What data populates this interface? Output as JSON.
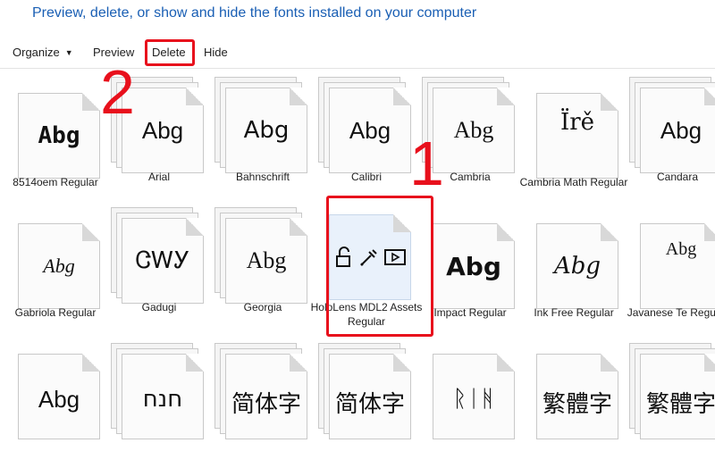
{
  "header": {
    "title": "Preview, delete, or show and hide the fonts installed on your computer"
  },
  "toolbar": {
    "organize": "Organize",
    "preview": "Preview",
    "delete": "Delete",
    "hide": "Hide"
  },
  "annotations": {
    "one": "1",
    "two": "2"
  },
  "fonts": [
    {
      "label": "8514oem Regular",
      "sample": "Abg"
    },
    {
      "label": "Arial",
      "sample": "Abg"
    },
    {
      "label": "Bahnschrift",
      "sample": "Abg"
    },
    {
      "label": "Calibri",
      "sample": "Abg"
    },
    {
      "label": "Cambria",
      "sample": "Abg"
    },
    {
      "label": "Cambria Math Regular",
      "sample": "Ïrě"
    },
    {
      "label": "Candara",
      "sample": "Abg"
    },
    {
      "label": "Gabriola Regular",
      "sample": "Abg"
    },
    {
      "label": "Gadugi",
      "sample": "ᏣᎳᎩ"
    },
    {
      "label": "Georgia",
      "sample": "Abg"
    },
    {
      "label": "HoloLens MDL2 Assets Regular",
      "sample": ""
    },
    {
      "label": "Impact Regular",
      "sample": "Abg"
    },
    {
      "label": "Ink Free Regular",
      "sample": "Abg"
    },
    {
      "label": "Javanese Te Regular",
      "sample": "Abg"
    },
    {
      "label": "",
      "sample": "Abg"
    },
    {
      "label": "",
      "sample": "חנח"
    },
    {
      "label": "",
      "sample": "简体字"
    },
    {
      "label": "",
      "sample": "简体字"
    },
    {
      "label": "",
      "sample": "ᚱᛁᚻ"
    },
    {
      "label": "",
      "sample": "繁體字"
    },
    {
      "label": "",
      "sample": "繁體字"
    }
  ],
  "colors": {
    "accent": "#1a5fb4",
    "highlight": "#e8101c"
  }
}
